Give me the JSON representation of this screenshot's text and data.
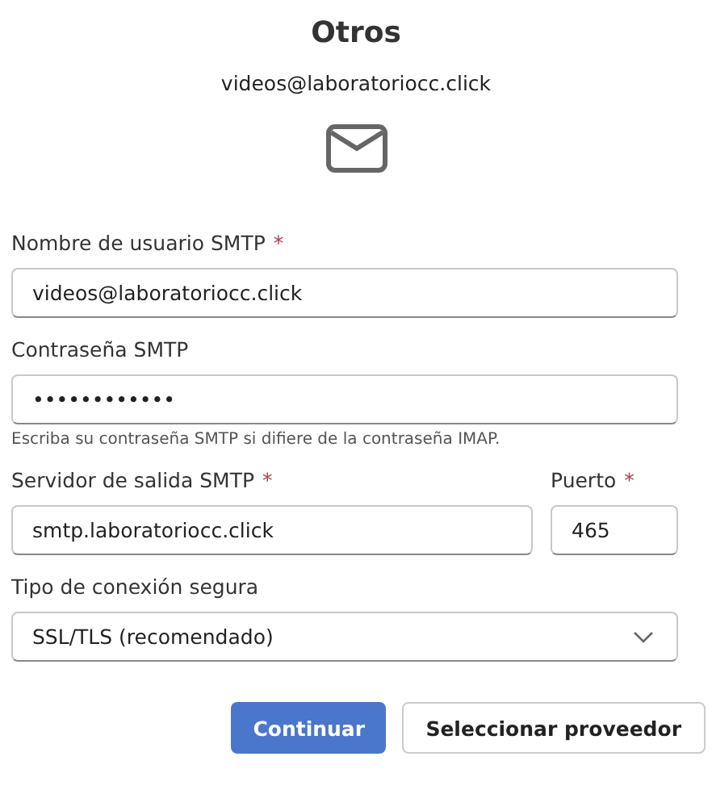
{
  "title": "Otros",
  "account": "videos@laboratoriocc.click",
  "username": {
    "label": "Nombre de usuario SMTP",
    "required_mark": "*",
    "value": "videos@laboratoriocc.click"
  },
  "password": {
    "label": "Contraseña SMTP",
    "value": "••••••••••••",
    "hint": "Escriba su contraseña SMTP si difiere de la contraseña IMAP."
  },
  "server": {
    "label": "Servidor de salida SMTP",
    "required_mark": "*",
    "value": "smtp.laboratoriocc.click"
  },
  "port": {
    "label": "Puerto",
    "required_mark": "*",
    "value": "465"
  },
  "security": {
    "label": "Tipo de conexión segura",
    "value": "SSL/TLS (recomendado)"
  },
  "buttons": [
    {
      "label": "Continuar",
      "kind": "primary"
    },
    {
      "label": "Seleccionar proveedor",
      "kind": "secondary"
    }
  ]
}
